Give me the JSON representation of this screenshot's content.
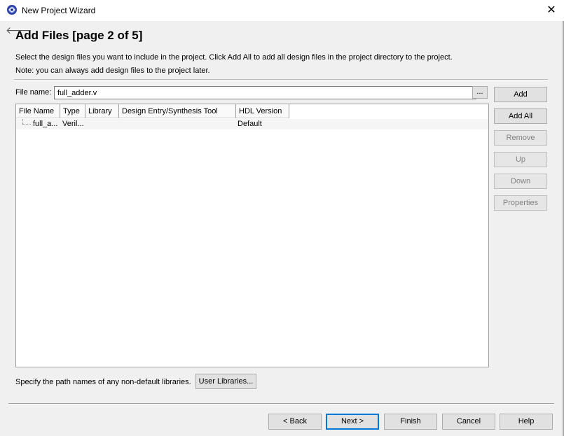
{
  "window": {
    "title": "New Project Wizard",
    "close_glyph": "✕"
  },
  "page": {
    "back_glyph": "🡐",
    "title": "Add Files [page 2 of 5]",
    "description_line1": "Select the design files you want to include in the project. Click Add All to add all design files in the project directory to the project.",
    "description_line2": "Note: you can always add design files to the project later."
  },
  "file_name": {
    "label": "File name:",
    "value": "full_adder.v",
    "browse_label": "..."
  },
  "side_buttons": {
    "add": "Add",
    "add_all": "Add All",
    "remove": "Remove",
    "up": "Up",
    "down": "Down",
    "properties": "Properties"
  },
  "file_table": {
    "columns": [
      "File Name",
      "Type",
      "Library",
      "Design Entry/Synthesis Tool",
      "HDL Version"
    ],
    "rows": [
      {
        "file_name": "full_a...",
        "type": "Veril...",
        "library": "",
        "tool": "",
        "hdl_version": "Default"
      }
    ]
  },
  "libraries": {
    "label": "Specify the path names of any non-default libraries.",
    "button": "User Libraries..."
  },
  "nav": {
    "back": "< Back",
    "next": "Next >",
    "finish": "Finish",
    "cancel": "Cancel",
    "help": "Help"
  },
  "colors": {
    "window_bg": "#f0f0f0",
    "titlebar_bg": "#ffffff",
    "accent": "#0078d7",
    "disabled_text": "#838383"
  }
}
